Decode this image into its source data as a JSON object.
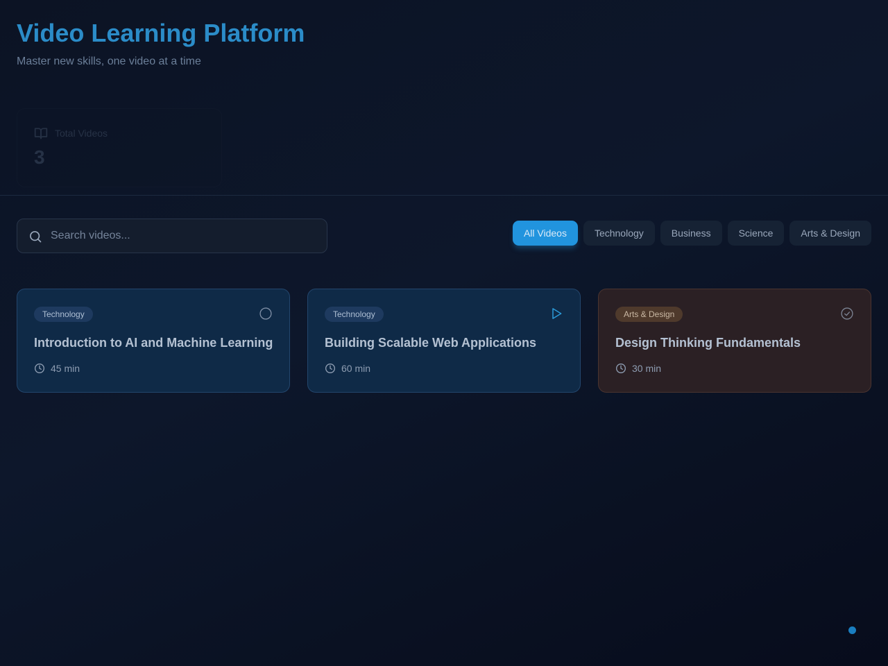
{
  "header": {
    "title": "Video Learning Platform",
    "subtitle": "Master new skills, one video at a time"
  },
  "stats": {
    "total_label": "Total Videos",
    "total_value": "3",
    "icon": "book-open-icon"
  },
  "search": {
    "placeholder": "Search videos...",
    "value": "",
    "icon": "search-icon"
  },
  "filters": [
    {
      "label": "All Videos",
      "active": true
    },
    {
      "label": "Technology",
      "active": false
    },
    {
      "label": "Business",
      "active": false
    },
    {
      "label": "Science",
      "active": false
    },
    {
      "label": "Arts & Design",
      "active": false
    }
  ],
  "videos": [
    {
      "category": "Technology",
      "title": "Introduction to AI and Machine Learning",
      "duration": "45 min",
      "status_icon": "circle-icon"
    },
    {
      "category": "Technology",
      "title": "Building Scalable Web Applications",
      "duration": "60 min",
      "status_icon": "play-icon"
    },
    {
      "category": "Arts & Design",
      "title": "Design Thinking Fundamentals",
      "duration": "30 min",
      "status_icon": "check-circle-icon"
    }
  ],
  "colors": {
    "accent": "#2194de",
    "title": "#2b8cc8",
    "tech_card_bg": "#0f2a47",
    "arts_card_bg": "#2b2024",
    "background": "#0c1324"
  }
}
